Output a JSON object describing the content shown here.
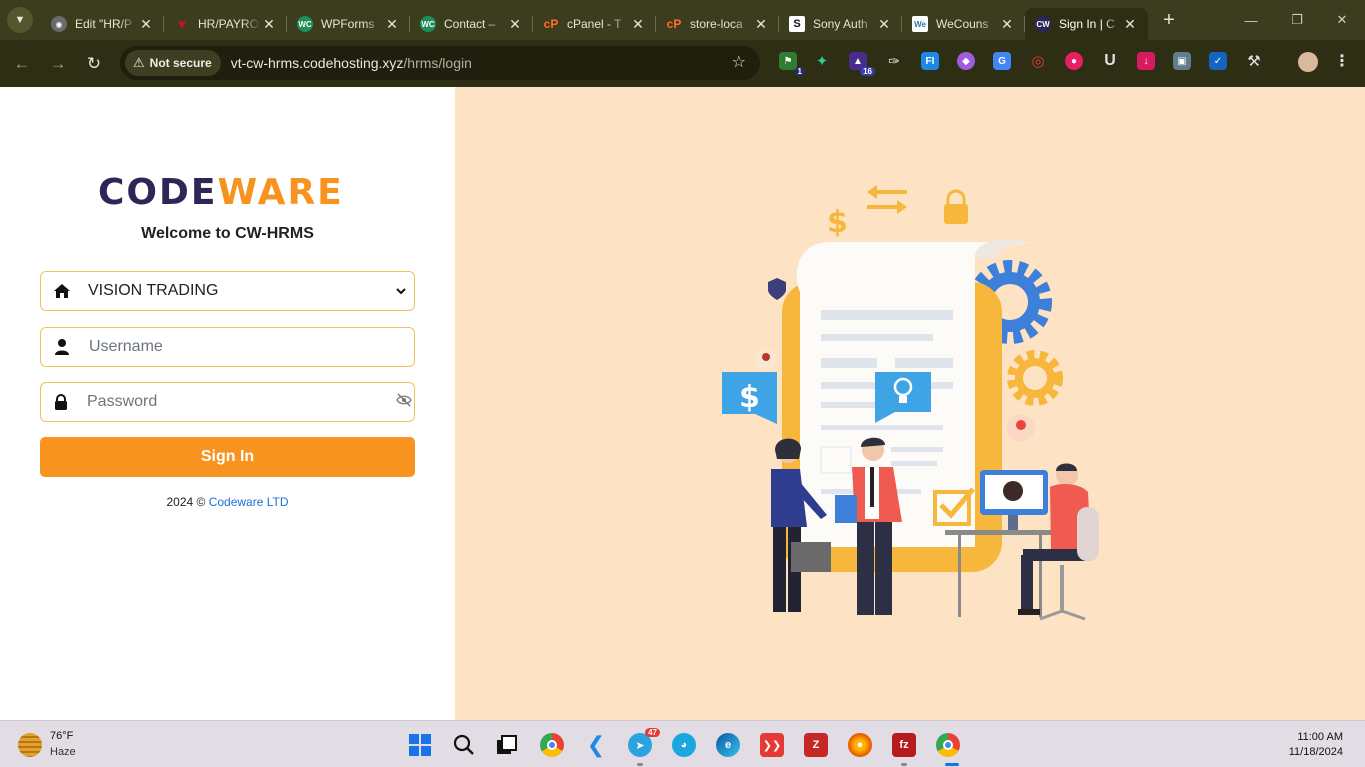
{
  "browser": {
    "tabs": [
      {
        "title": "Edit \"HR/P",
        "favicon": "globe-icon",
        "color": "#6b6b6b"
      },
      {
        "title": "HR/PAYRO",
        "favicon": "red-v-icon",
        "color": "#c8102e"
      },
      {
        "title": "WPForms",
        "favicon": "wc-icon",
        "color": "#1f8f5a"
      },
      {
        "title": "Contact –",
        "favicon": "wc-icon",
        "color": "#1f8f5a"
      },
      {
        "title": "cPanel - T",
        "favicon": "cpanel-icon",
        "color": "#ff6c2c"
      },
      {
        "title": "store-loca",
        "favicon": "cpanel-icon",
        "color": "#ff6c2c"
      },
      {
        "title": "Sony Auth",
        "favicon": "s-icon",
        "color": "#111111"
      },
      {
        "title": "WeCouns",
        "favicon": "we-icon",
        "color": "#ffffff"
      },
      {
        "title": "Sign In | C",
        "favicon": "cw-icon",
        "color": "#2c2756",
        "active": true
      }
    ],
    "new_tab": "+",
    "address": {
      "security_label": "Not secure",
      "url_host": "vt-cw-hrms.codehosting.xyz",
      "url_path": "/hrms/login"
    },
    "extension_badges": {
      "first": "1",
      "grad": "16"
    }
  },
  "login": {
    "logo_part1": "CODE",
    "logo_part2": "WARE",
    "welcome": "Welcome to CW-HRMS",
    "company_selected": "VISION TRADING",
    "username_placeholder": "Username",
    "password_placeholder": "Password",
    "signin_label": "Sign In",
    "copyright_prefix": "2024 © ",
    "copyright_link": "Codeware LTD",
    "accent_color": "#f7931e",
    "brand_color": "#2c2756"
  },
  "taskbar": {
    "temperature": "76°F",
    "condition": "Haze",
    "time": "11:00 AM",
    "date": "11/18/2024",
    "telegram_badge": "47"
  }
}
